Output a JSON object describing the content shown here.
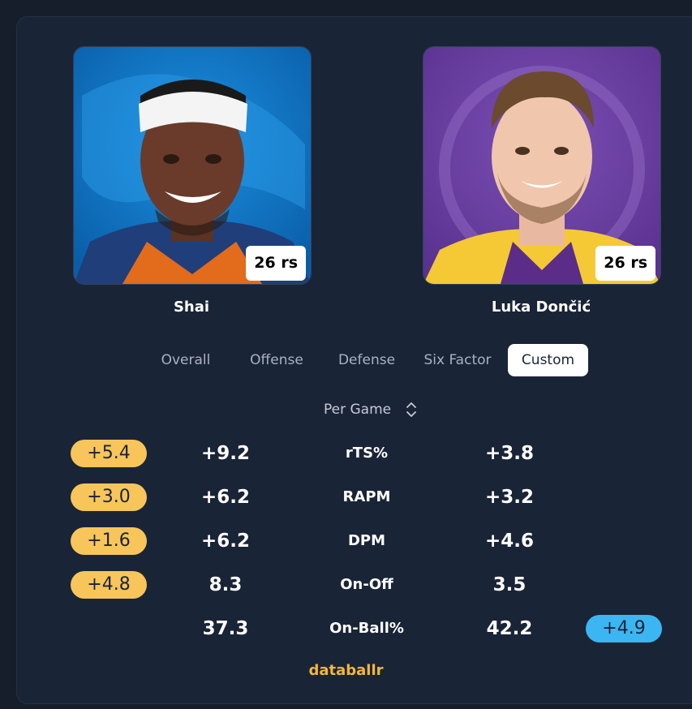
{
  "players": [
    {
      "name": "Shai",
      "badge": "26 rs",
      "team_color": "#0a74c8"
    },
    {
      "name": "Luka Dončić",
      "badge": "26 rs",
      "team_color": "#6a3fa0"
    }
  ],
  "tabs": [
    "Overall",
    "Offense",
    "Defense",
    "Six Factor",
    "Custom"
  ],
  "active_tab": "Custom",
  "mode_select": {
    "value": "Per Game",
    "icon": "chevron-updown-icon"
  },
  "stats": [
    {
      "label": "rTS%",
      "p1": "+9.2",
      "p2": "+3.8",
      "diff": "+5.4",
      "leader": "p1"
    },
    {
      "label": "RAPM",
      "p1": "+6.2",
      "p2": "+3.2",
      "diff": "+3.0",
      "leader": "p1"
    },
    {
      "label": "DPM",
      "p1": "+6.2",
      "p2": "+4.6",
      "diff": "+1.6",
      "leader": "p1"
    },
    {
      "label": "On-Off",
      "p1": "8.3",
      "p2": "3.5",
      "diff": "+4.8",
      "leader": "p1"
    },
    {
      "label": "On-Ball%",
      "p1": "37.3",
      "p2": "42.2",
      "diff": "+4.9",
      "leader": "p2"
    }
  ],
  "branding": "databallr",
  "colors": {
    "p1_highlight": "#f7c55a",
    "p2_highlight": "#3bb6f3",
    "brand": "#f4b63e"
  }
}
